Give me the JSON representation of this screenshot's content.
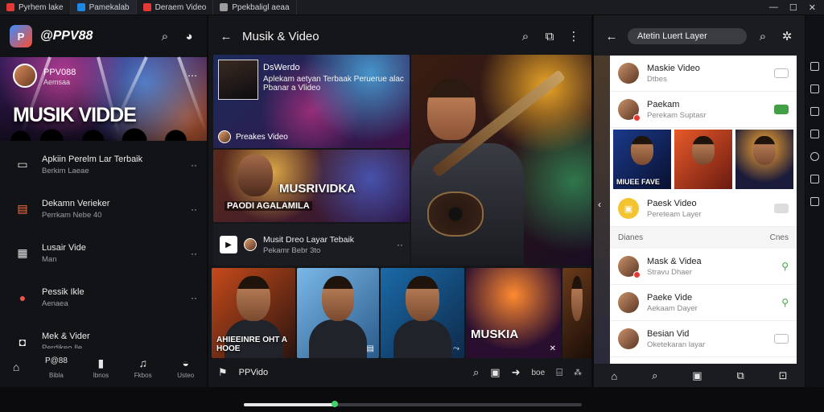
{
  "tabs": [
    {
      "label": "Pyrhem lake",
      "color": "#e53935"
    },
    {
      "label": "Pamekalab",
      "color": "#1e88e5"
    },
    {
      "label": "Deraem Video",
      "color": "#e53935"
    },
    {
      "label": "Ppekbaligl aeaa",
      "color": "#9e9e9e"
    }
  ],
  "window": {
    "minimize": "—",
    "maximize": "☐",
    "close": "✕"
  },
  "panel1": {
    "brand": "@PPV88",
    "hero": {
      "channel": "PPV088",
      "channel_sub": "Aemsaa",
      "title": "MUSIK VIDDE"
    },
    "items": [
      {
        "title": "Apkiin Perelm Lar Terbaik",
        "sub": "Berkim Laeae",
        "icon": "monitor-icon",
        "icon_char": "▭",
        "icon_color": "#e8e8ea"
      },
      {
        "title": "Dekamn Verieker",
        "sub": "Perrkam Nebe 40",
        "icon": "clipboard-icon",
        "icon_char": "▤",
        "icon_color": "#ff7043"
      },
      {
        "title": "Lusair Vide",
        "sub": "Man",
        "icon": "video-list-icon",
        "icon_char": "▦",
        "icon_color": "#e8e8ea"
      },
      {
        "title": "Pessik Ikle",
        "sub": "Aenaea",
        "icon": "music-circle-icon",
        "icon_char": "●",
        "icon_color": "#ef5350"
      },
      {
        "title": "Mek & Vider",
        "sub": "Perdikeo Ile",
        "icon": "camera-icon",
        "icon_char": "◘",
        "icon_color": "#e8e8ea"
      }
    ],
    "nav": [
      {
        "label": "",
        "icon": "home-icon",
        "char": "⌂"
      },
      {
        "label": "Bibla",
        "icon": "ppv-icon",
        "char": "P@88"
      },
      {
        "label": "Ibnos",
        "icon": "shorts-icon",
        "char": "▮"
      },
      {
        "label": "Fkbos",
        "icon": "music-icon",
        "char": "♫"
      },
      {
        "label": "Usteo",
        "icon": "profile-icon",
        "char": "◒"
      }
    ]
  },
  "panel2": {
    "title": "Musik & Video",
    "featured": {
      "tag": "DsWerdo",
      "desc": "Aplekam aetyan Terbaak Peruerue alac Pbanar a Vlideo",
      "foot": "Preakes Video"
    },
    "second": {
      "word": "MUSRIVIDKA",
      "word2": "PAODI AGALAMILA"
    },
    "row": {
      "title": "Musit Dreo Layar Tebaik",
      "sub": "Pekamr Bebr 3to"
    },
    "grid": [
      {
        "label": "AHIEEINRE OHT A HOOE",
        "badge": ""
      },
      {
        "label": "",
        "badge": ""
      },
      {
        "label": "",
        "badge": ""
      },
      {
        "label": "MUSKIA",
        "badge": ""
      },
      {
        "label": "",
        "badge": ""
      }
    ],
    "nav": {
      "app": "PPVido",
      "label": "boe"
    }
  },
  "panel3": {
    "search": "Atetin Luert Layer",
    "rows_top": [
      {
        "title": "Maskie Video",
        "sub": "Dtbes"
      },
      {
        "title": "Paekam",
        "sub": "Perekam Suptasr"
      }
    ],
    "thumbs": [
      {
        "label": "MIUEE FAVE"
      },
      {
        "label": ""
      },
      {
        "label": ""
      }
    ],
    "row_mid": {
      "title": "Paesk Video",
      "sub": "Pereteam Layer"
    },
    "section": {
      "left": "Dianes",
      "right": "Cnes"
    },
    "rows_bottom": [
      {
        "title": "Mask & Videa",
        "sub": "Stravu Dhaer"
      },
      {
        "title": "Paeke Vide",
        "sub": "Aekaam Dayer"
      },
      {
        "title": "Besian Vid",
        "sub": "Oketekaran layar"
      }
    ]
  },
  "player": {
    "progress": 0.27
  },
  "colors": {
    "accent": "#ff3d00",
    "green": "#43a047"
  }
}
